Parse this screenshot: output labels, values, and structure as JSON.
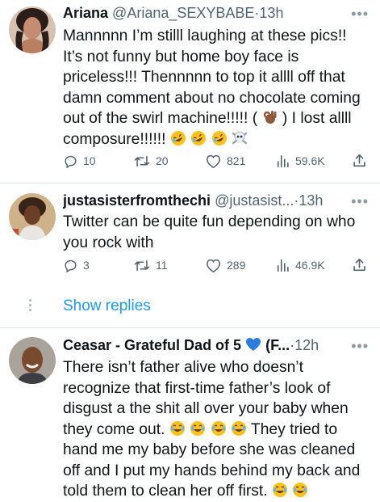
{
  "tweets": [
    {
      "name": "Ariana",
      "handle": "@Ariana_SEXYBABE",
      "dot": "·",
      "time": "13h",
      "text_lines": [
        "Mannnnn I’m stilll laughing at these pics!!",
        "It’s not funny but home boy face is",
        "priceless!!! Thennnnn to top it allll off that",
        "damn comment about no chocolate coming",
        "out of the swirl machine!!!!! (",
        ") I lost allll",
        "composure!!!!!!"
      ],
      "emojis_line5": [
        "ok-hand-emoji"
      ],
      "emojis_line7": [
        "rofl-emoji",
        "rofl-emoji",
        "rofl-emoji",
        "skull-crossbones-emoji"
      ],
      "replies": "10",
      "retweets": "20",
      "likes": "821",
      "views": "59.6K"
    },
    {
      "name": "justasisterfromthechi",
      "handle": "@justasist...",
      "dot": "·",
      "time": "13h",
      "text_lines": [
        "Twitter can be quite fun depending on who",
        "you rock with"
      ],
      "replies": "3",
      "retweets": "11",
      "likes": "289",
      "views": "46.9K"
    },
    {
      "name": "Ceasar - Grateful Dad of 5",
      "handle": "(F...",
      "dot": "·",
      "time": "12h",
      "text_lines": [
        "There isn’t father alive who doesn’t",
        "recognize that first-time father’s look of",
        "disgust a the shit all over your baby when",
        "they come out.",
        "They tried to",
        "hand me my baby before she was cleaned",
        "off and I put my hands behind my back and",
        "told them to clean her off first."
      ],
      "verified_emoji": "blue-heart-emoji"
    }
  ],
  "show_replies": "Show replies",
  "colors": {
    "link": "#1d9bf0",
    "muted": "#536471",
    "divider": "#e1e8ed"
  }
}
